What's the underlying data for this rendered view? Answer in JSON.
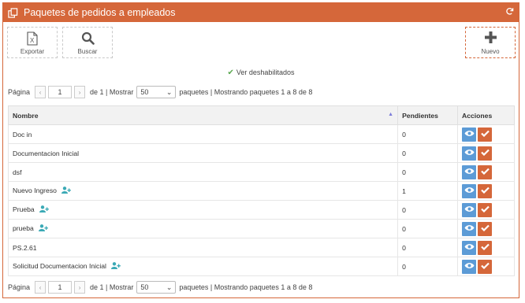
{
  "header": {
    "title": "Paquetes de pedidos a empleados"
  },
  "toolbar": {
    "export_label": "Exportar",
    "search_label": "Buscar",
    "new_label": "Nuevo"
  },
  "toggle": {
    "label": "Ver deshabilitados"
  },
  "pager": {
    "page_label": "Página",
    "page_value": "1",
    "of_label": "de 1 | Mostrar",
    "page_size": "50",
    "summary": "paquetes | Mostrando paquetes 1 a 8 de 8"
  },
  "table": {
    "headers": {
      "name": "Nombre",
      "pending": "Pendientes",
      "actions": "Acciones"
    },
    "rows": [
      {
        "name": "Doc in",
        "pending": "0",
        "user_icon": false
      },
      {
        "name": "Documentacion Inicial",
        "pending": "0",
        "user_icon": false
      },
      {
        "name": "dsf",
        "pending": "0",
        "user_icon": false
      },
      {
        "name": "Nuevo Ingreso",
        "pending": "1",
        "user_icon": true
      },
      {
        "name": "Prueba",
        "pending": "0",
        "user_icon": true
      },
      {
        "name": "prueba",
        "pending": "0",
        "user_icon": true
      },
      {
        "name": "PS.2.61",
        "pending": "0",
        "user_icon": false
      },
      {
        "name": "Solicitud Documentacion Inicial",
        "pending": "0",
        "user_icon": true
      }
    ]
  },
  "colors": {
    "accent": "#d5673a",
    "view_button": "#5c9bd6",
    "user_icon": "#3aa9b5"
  }
}
